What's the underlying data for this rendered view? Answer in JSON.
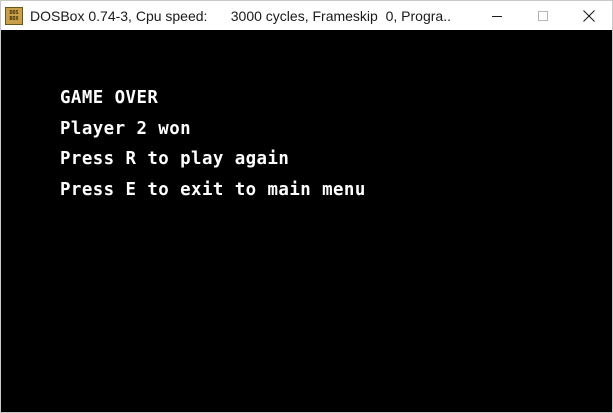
{
  "window": {
    "title": "DOSBox 0.74-3, Cpu speed:      3000 cycles, Frameskip  0, Progra...",
    "icon_top": "DOS",
    "icon_bottom": "BOX",
    "icon": "dosbox-icon",
    "controls": [
      "minimize-icon",
      "maximize-icon",
      "close-icon"
    ]
  },
  "screen": {
    "background": "#000000",
    "text_color": "#ffffff",
    "lines": [
      "GAME OVER",
      "Player 2 won",
      "Press R to play again",
      "Press E to exit to main menu"
    ]
  }
}
